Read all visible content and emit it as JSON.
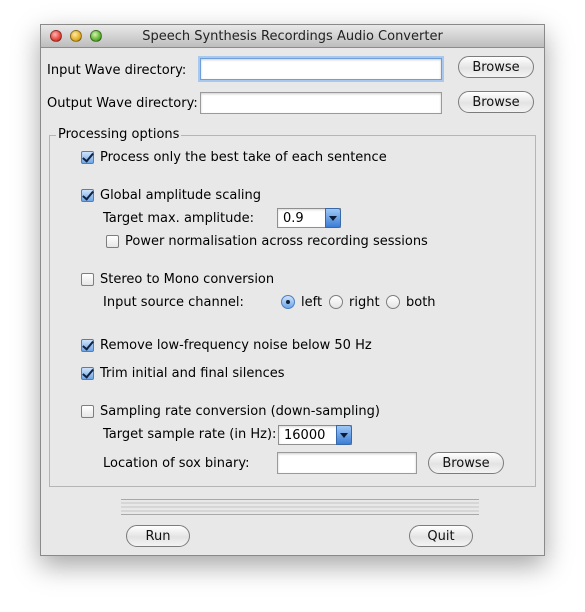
{
  "window": {
    "title": "Speech Synthesis Recordings Audio Converter"
  },
  "input_dir": {
    "label": "Input Wave directory:",
    "value": "",
    "button": "Browse"
  },
  "output_dir": {
    "label": "Output Wave directory:",
    "value": "",
    "button": "Browse"
  },
  "processing": {
    "title": "Processing options",
    "best_take": {
      "label": "Process only the best take of each sentence",
      "checked": true
    },
    "global_amp": {
      "label": "Global amplitude scaling",
      "checked": true
    },
    "target_amp": {
      "label": "Target max. amplitude:",
      "value": "0.9"
    },
    "power_norm": {
      "label": "Power normalisation across recording sessions",
      "checked": false
    },
    "stereo_mono": {
      "label": "Stereo to Mono conversion",
      "checked": false
    },
    "source_channel": {
      "label": "Input source channel:",
      "options": [
        "left",
        "right",
        "both"
      ],
      "selected": "left"
    },
    "low_freq": {
      "label": "Remove low-frequency noise below 50 Hz",
      "checked": true
    },
    "trim": {
      "label": "Trim initial and final silences",
      "checked": true
    },
    "sampling": {
      "label": "Sampling rate conversion (down-sampling)",
      "checked": false
    },
    "target_rate": {
      "label": "Target sample rate (in Hz):",
      "value": "16000"
    },
    "sox": {
      "label": "Location of sox binary:",
      "value": "",
      "button": "Browse"
    }
  },
  "footer": {
    "run": "Run",
    "quit": "Quit"
  }
}
